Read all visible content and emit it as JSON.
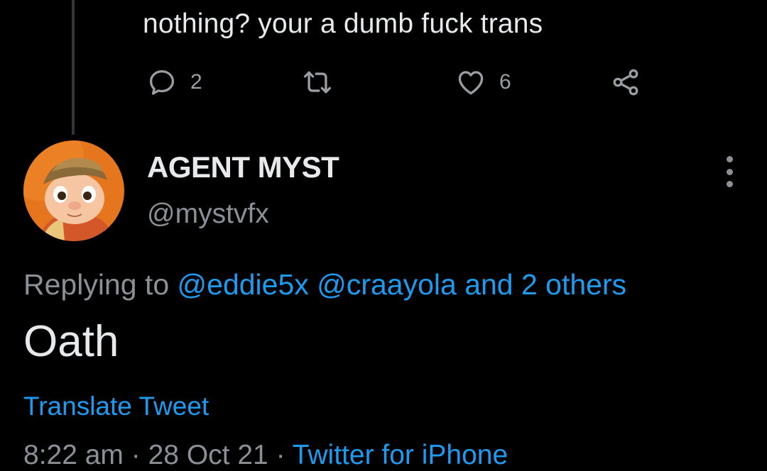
{
  "previous_tweet": {
    "text": "nothing? your a dumb fuck trans",
    "actions": {
      "reply_count": "2",
      "like_count": "6"
    }
  },
  "tweet": {
    "display_name": "AGENT MYST",
    "handle": "@mystvfx",
    "replying_prefix": "Replying to",
    "mention_1": "@eddie5x",
    "mention_2": "@craayola",
    "others": "and 2 others",
    "text": "Oath",
    "translate_label": "Translate Tweet",
    "time": "8:22 am",
    "separator": "·",
    "date": "28 Oct 21",
    "source": "Twitter for iPhone"
  },
  "colors": {
    "background": "#000000",
    "text_primary": "#e7e9ea",
    "text_secondary": "#8b9096",
    "accent": "#1d9bf0",
    "thread_line": "#333639"
  },
  "icons": {
    "reply": "reply-icon",
    "retweet": "retweet-icon",
    "like": "like-icon",
    "share": "share-icon",
    "more": "more-icon",
    "avatar": "avatar"
  }
}
